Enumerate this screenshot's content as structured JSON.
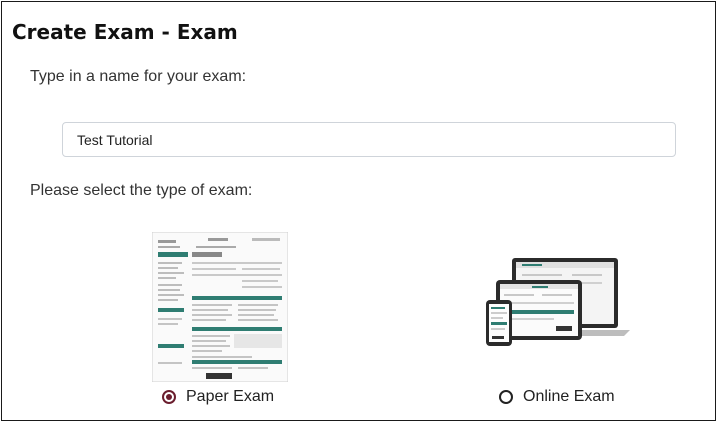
{
  "page": {
    "title": "Create Exam - Exam",
    "name_prompt": "Type in a name for your exam:",
    "name_input_value": "Test Tutorial",
    "type_prompt": "Please select the type of exam:"
  },
  "exam_types": [
    {
      "label": "Paper Exam",
      "selected": true,
      "icon": "paper-exam-thumbnail"
    },
    {
      "label": "Online Exam",
      "selected": false,
      "icon": "online-exam-devices-illustration"
    }
  ],
  "colors": {
    "radio_selected": "#6b1e2e",
    "accent_teal": "#2f7d72",
    "border": "#1a1a1a"
  }
}
